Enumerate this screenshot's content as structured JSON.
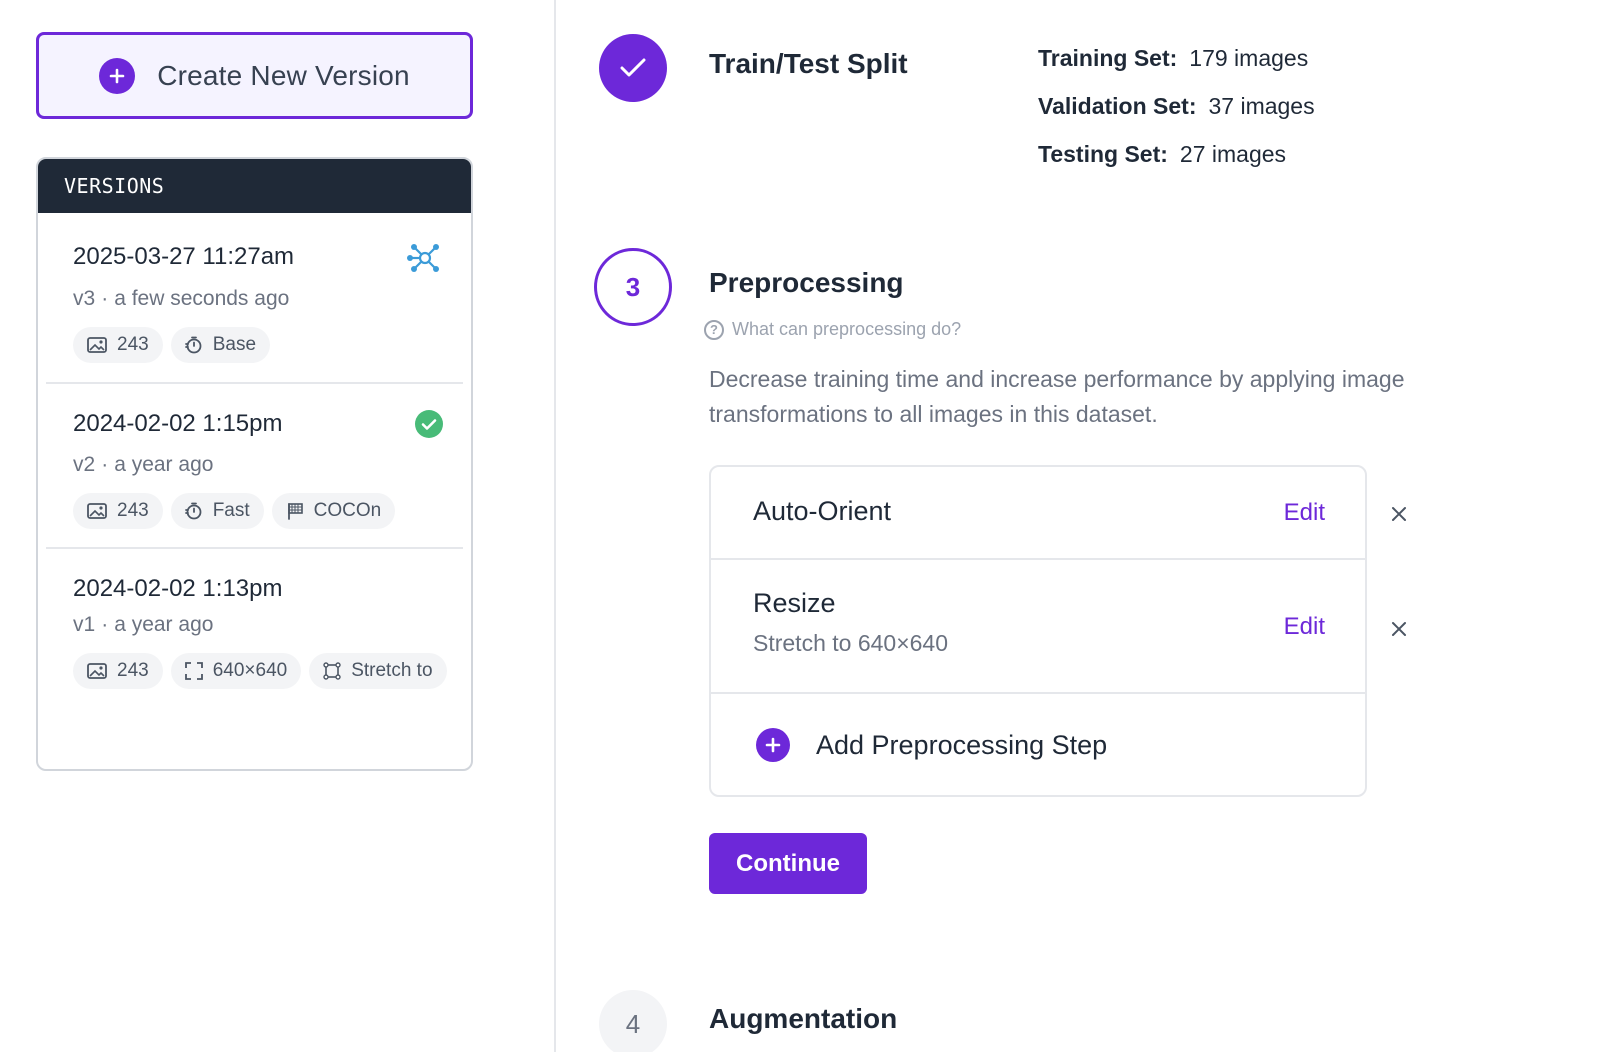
{
  "create_button": {
    "label": "Create New Version"
  },
  "versions": {
    "header": "VERSIONS",
    "items": [
      {
        "date": "2025-03-27 11:27am",
        "version": "v3",
        "age": "a few seconds ago",
        "status_icon": "training-network-icon",
        "chips": [
          {
            "icon": "image-icon",
            "label": "243"
          },
          {
            "icon": "stopwatch-icon",
            "label": "Base"
          }
        ]
      },
      {
        "date": "2024-02-02 1:15pm",
        "version": "v2",
        "age": "a year ago",
        "status_icon": "check-circle-icon",
        "chips": [
          {
            "icon": "image-icon",
            "label": "243"
          },
          {
            "icon": "stopwatch-icon",
            "label": "Fast"
          },
          {
            "icon": "flag-icon",
            "label": "COCOn"
          }
        ]
      },
      {
        "date": "2024-02-02 1:13pm",
        "version": "v1",
        "age": "a year ago",
        "chips": [
          {
            "icon": "image-icon",
            "label": "243"
          },
          {
            "icon": "resize-icon",
            "label": "640×640"
          },
          {
            "icon": "stretch-icon",
            "label": "Stretch to"
          }
        ]
      }
    ]
  },
  "train_test_split": {
    "title": "Train/Test Split",
    "rows": [
      {
        "label": "Training Set:",
        "value": "179 images"
      },
      {
        "label": "Validation Set:",
        "value": "37 images"
      },
      {
        "label": "Testing Set:",
        "value": "27 images"
      }
    ]
  },
  "preprocessing": {
    "step_number": "3",
    "title": "Preprocessing",
    "help_text": "What can preprocessing do?",
    "description": "Decrease training time and increase performance by applying image transformations to all images in this dataset.",
    "steps": [
      {
        "name": "Auto-Orient",
        "detail": "",
        "edit_label": "Edit"
      },
      {
        "name": "Resize",
        "detail": "Stretch to 640×640",
        "edit_label": "Edit"
      }
    ],
    "add_step_label": "Add Preprocessing Step",
    "continue_label": "Continue"
  },
  "augmentation": {
    "step_number": "4",
    "title": "Augmentation"
  },
  "colors": {
    "accent": "#6d28d9",
    "header_dark": "#1f2937",
    "success": "#48bb78",
    "network_blue": "#3b9bd8"
  }
}
